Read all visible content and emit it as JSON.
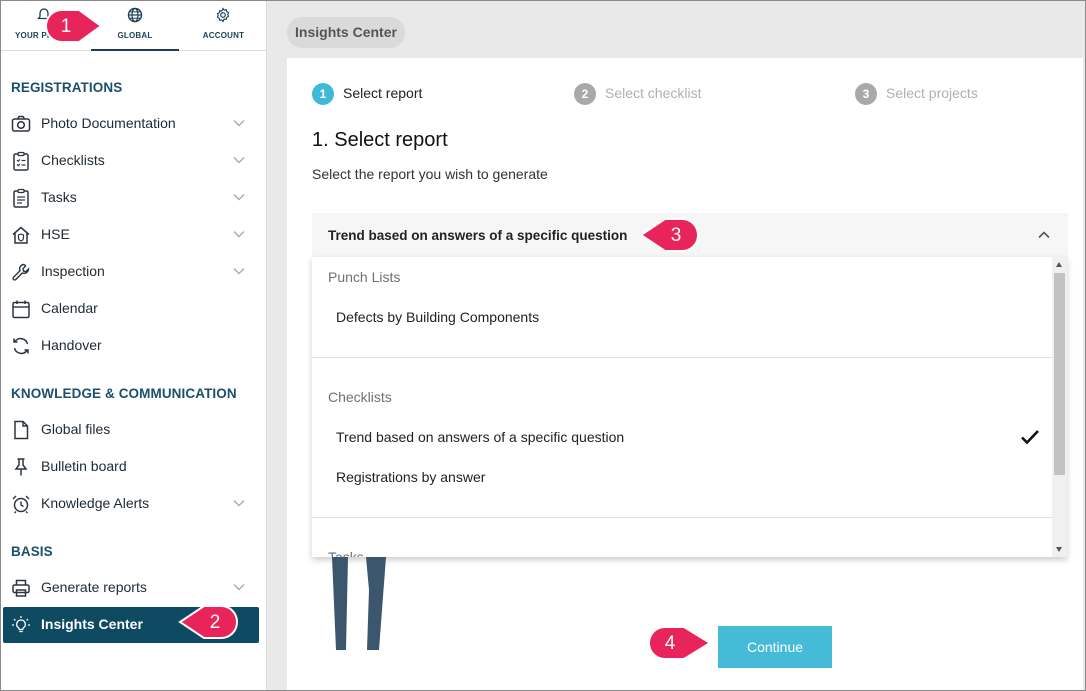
{
  "topnav": {
    "tabs": [
      {
        "label": "YOUR PR",
        "icon": "bell-icon"
      },
      {
        "label": "GLOBAL",
        "icon": "globe-icon"
      },
      {
        "label": "ACCOUNT",
        "icon": "gear-icon"
      }
    ]
  },
  "sidebar": {
    "sections": [
      {
        "title": "REGISTRATIONS"
      },
      {
        "title": "KNOWLEDGE & COMMUNICATION"
      },
      {
        "title": "BASIS"
      }
    ],
    "items": [
      {
        "label": "Photo Documentation",
        "icon": "camera-icon"
      },
      {
        "label": "Checklists",
        "icon": "clipboard-checklist-icon"
      },
      {
        "label": "Tasks",
        "icon": "clipboard-tasks-icon"
      },
      {
        "label": "HSE",
        "icon": "house-shield-icon"
      },
      {
        "label": "Inspection",
        "icon": "wrench-icon"
      },
      {
        "label": "Calendar",
        "icon": "calendar-icon"
      },
      {
        "label": "Handover",
        "icon": "refresh-icon"
      },
      {
        "label": "Global files",
        "icon": "file-icon"
      },
      {
        "label": "Bulletin board",
        "icon": "pin-icon"
      },
      {
        "label": "Knowledge Alerts",
        "icon": "alarm-clock-icon"
      },
      {
        "label": "Generate reports",
        "icon": "printer-icon"
      },
      {
        "label": "Insights Center",
        "icon": "lightbulb-icon"
      }
    ]
  },
  "main": {
    "breadcrumb": "Insights Center",
    "steps": [
      {
        "num": "1",
        "label": "Select report"
      },
      {
        "num": "2",
        "label": "Select checklist"
      },
      {
        "num": "3",
        "label": "Select projects"
      }
    ],
    "heading": "1. Select report",
    "subheading": "Select the report you wish to generate",
    "selected_report": "Trend based on answers of a specific question",
    "dropdown": {
      "groups": [
        {
          "label": "Punch Lists",
          "options": [
            "Defects by Building Components"
          ]
        },
        {
          "label": "Checklists",
          "options": [
            "Trend based on answers of a specific question",
            "Registrations by answer"
          ]
        },
        {
          "label": "Tasks",
          "options": []
        }
      ]
    },
    "continue_label": "Continue"
  },
  "callouts": [
    "1",
    "2",
    "3",
    "4"
  ],
  "colors": {
    "accent": "#45bbd8",
    "active_nav": "#0e4a62",
    "callout": "#e8245a",
    "step_active": "#3fb9d6"
  }
}
